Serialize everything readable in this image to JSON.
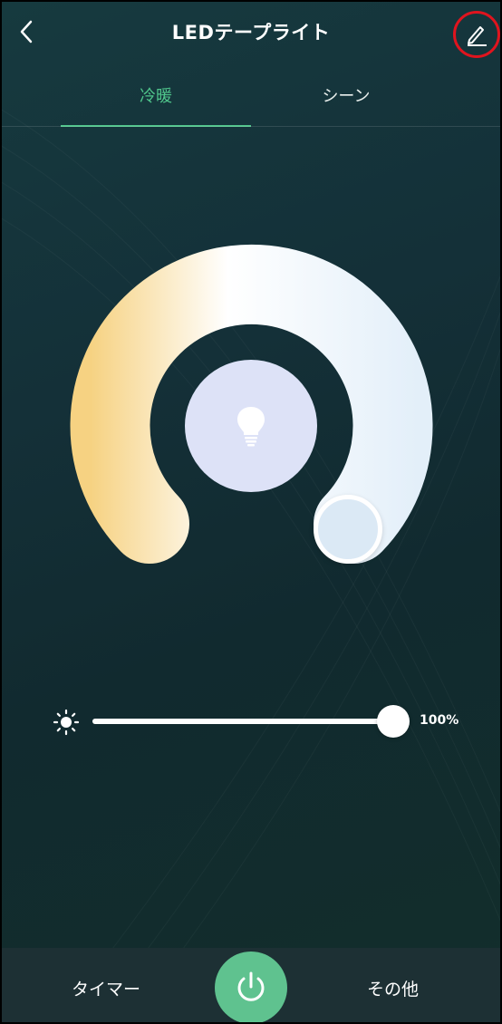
{
  "header": {
    "title": "LEDテープライト",
    "back_icon": "chevron-left-icon",
    "edit_icon": "pencil-edit-icon"
  },
  "tabs": [
    {
      "label": "冷暖",
      "active": true
    },
    {
      "label": "シーン",
      "active": false
    }
  ],
  "color_temperature": {
    "center_icon": "light-bulb-icon",
    "warm_color": "#f6d282",
    "neutral_color": "#ffffff",
    "cool_color": "#e3eff9"
  },
  "brightness": {
    "icon": "sun-icon",
    "value": 100,
    "label": "100%"
  },
  "bottom_bar": {
    "timer_label": "タイマー",
    "power_icon": "power-icon",
    "more_label": "その他"
  },
  "colors": {
    "accent": "#4fc58b",
    "power_button": "#5fc28f",
    "highlight_circle": "#e0141e"
  }
}
